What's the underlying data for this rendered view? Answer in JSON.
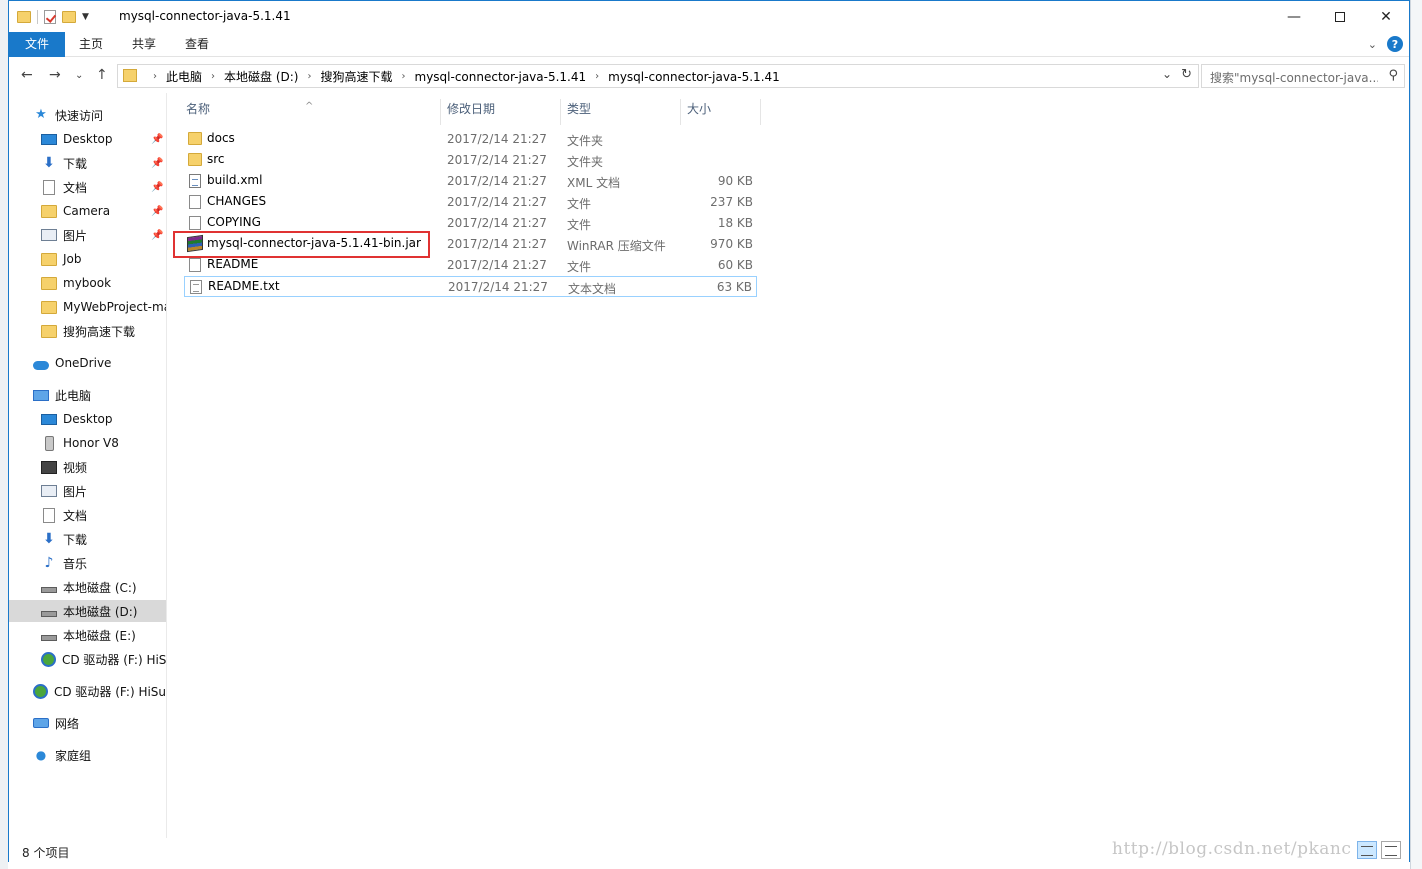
{
  "window": {
    "title": "mysql-connector-java-5.1.41",
    "controls": {
      "minimize": "—",
      "maximize": "",
      "close": "✕"
    }
  },
  "ribbon": {
    "tabs": [
      "文件",
      "主页",
      "共享",
      "查看"
    ],
    "help": "?"
  },
  "address": {
    "crumbs": [
      "此电脑",
      "本地磁盘 (D:)",
      "搜狗高速下载",
      "mysql-connector-java-5.1.41",
      "mysql-connector-java-5.1.41"
    ],
    "search_placeholder": "搜索\"mysql-connector-java..."
  },
  "nav": {
    "quick_access": "快速访问",
    "quick_items": [
      "Desktop",
      "下载",
      "文档",
      "Camera",
      "图片",
      "Job",
      "mybook",
      "MyWebProject-ma",
      "搜狗高速下载"
    ],
    "onedrive": "OneDrive",
    "this_pc": "此电脑",
    "pc_items": [
      "Desktop",
      "Honor V8",
      "视频",
      "图片",
      "文档",
      "下载",
      "音乐",
      "本地磁盘 (C:)",
      "本地磁盘 (D:)",
      "本地磁盘 (E:)",
      "CD 驱动器 (F:) HiSui"
    ],
    "cd_drive": "CD 驱动器 (F:) HiSui",
    "network": "网络",
    "homegroup": "家庭组",
    "selected": "本地磁盘 (D:)"
  },
  "columns": {
    "name": "名称",
    "date": "修改日期",
    "type": "类型",
    "size": "大小"
  },
  "files": [
    {
      "name": "docs",
      "date": "2017/2/14 21:27",
      "type": "文件夹",
      "size": "",
      "icon": "folder-icon"
    },
    {
      "name": "src",
      "date": "2017/2/14 21:27",
      "type": "文件夹",
      "size": "",
      "icon": "folder-icon"
    },
    {
      "name": "build.xml",
      "date": "2017/2/14 21:27",
      "type": "XML 文档",
      "size": "90 KB",
      "icon": "xml-file-icon"
    },
    {
      "name": "CHANGES",
      "date": "2017/2/14 21:27",
      "type": "文件",
      "size": "237 KB",
      "icon": "file-icon"
    },
    {
      "name": "COPYING",
      "date": "2017/2/14 21:27",
      "type": "文件",
      "size": "18 KB",
      "icon": "file-icon"
    },
    {
      "name": "mysql-connector-java-5.1.41-bin.jar",
      "date": "2017/2/14 21:27",
      "type": "WinRAR 压缩文件",
      "size": "970 KB",
      "icon": "winrar-archive-icon"
    },
    {
      "name": "README",
      "date": "2017/2/14 21:27",
      "type": "文件",
      "size": "60 KB",
      "icon": "file-icon"
    },
    {
      "name": "README.txt",
      "date": "2017/2/14 21:27",
      "type": "文本文档",
      "size": "63 KB",
      "icon": "text-file-icon"
    }
  ],
  "status": {
    "count": "8 个项目"
  },
  "watermark": "http://blog.csdn.net/pkanc",
  "colors": {
    "accent": "#1979ca",
    "highlight": "#e03232",
    "selected_nav": "#d9d9d9"
  }
}
